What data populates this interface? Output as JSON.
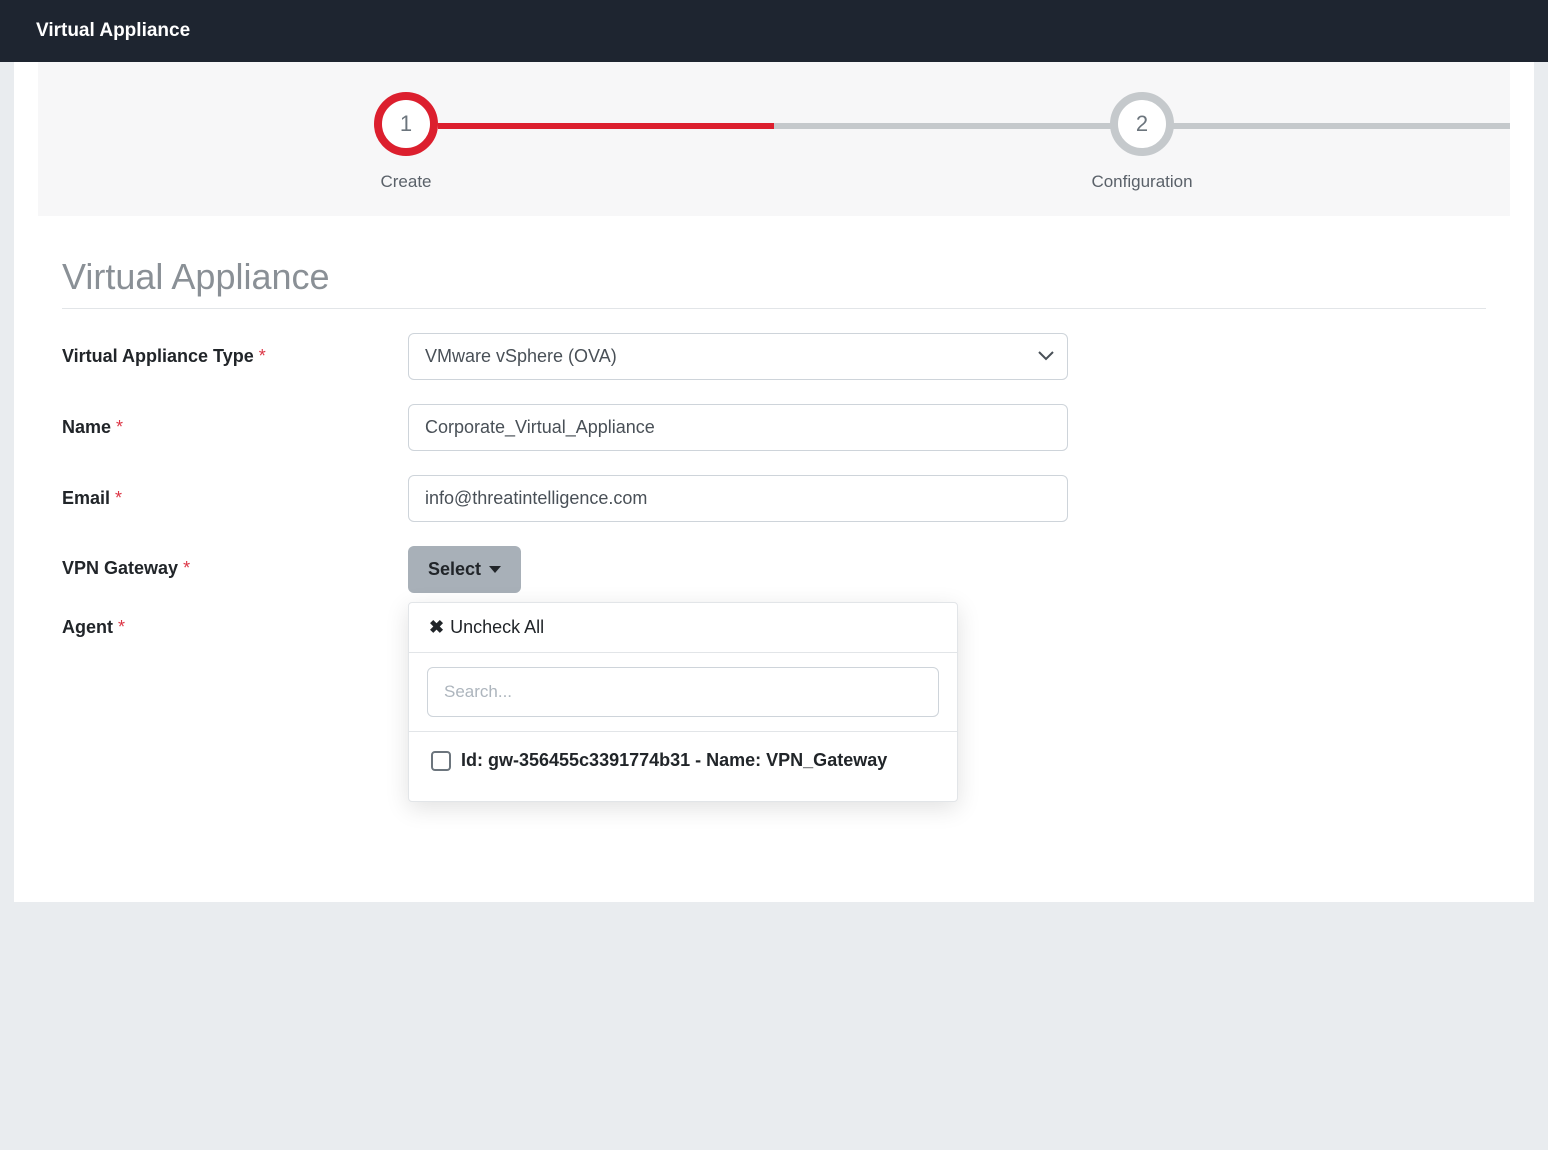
{
  "header": {
    "title": "Virtual Appliance"
  },
  "wizard": {
    "steps": [
      {
        "number": "1",
        "label": "Create"
      },
      {
        "number": "2",
        "label": "Configuration"
      }
    ]
  },
  "form": {
    "section_title": "Virtual Appliance",
    "fields": {
      "type": {
        "label": "Virtual Appliance Type",
        "value": "VMware vSphere (OVA)"
      },
      "name": {
        "label": "Name",
        "value": "Corporate_Virtual_Appliance"
      },
      "email": {
        "label": "Email",
        "value": "info@threatintelligence.com"
      },
      "vpn_gateway": {
        "label": "VPN Gateway",
        "button": "Select",
        "dropdown": {
          "uncheck_all": "Uncheck All",
          "search_placeholder": "Search...",
          "option1": "Id: gw-356455c3391774b31 - Name: VPN_Gateway"
        }
      },
      "agent": {
        "label": "Agent"
      }
    },
    "required_mark": "*"
  }
}
